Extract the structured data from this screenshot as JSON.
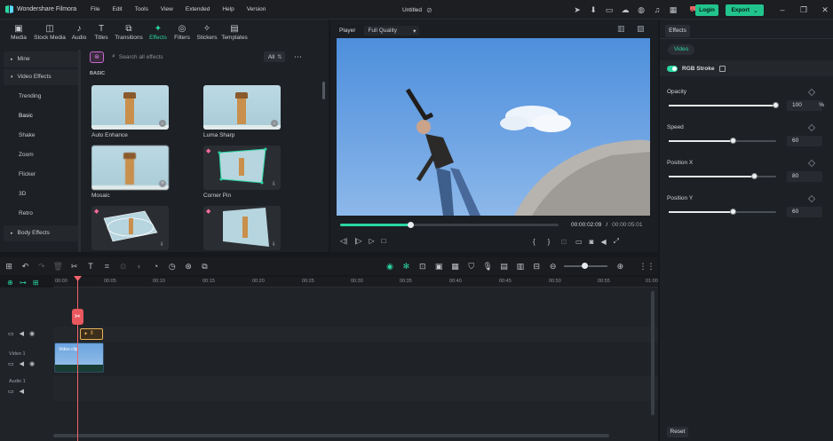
{
  "app": {
    "name": "Wondershare Filmora",
    "doc_title": "Untitled"
  },
  "menu": [
    "File",
    "Edit",
    "Tools",
    "View",
    "Extended",
    "Help",
    "Version"
  ],
  "header_buttons": {
    "login": "Login",
    "export": "Export"
  },
  "library_tabs": [
    {
      "label": "Media",
      "icon": "media-icon"
    },
    {
      "label": "Stock Media",
      "icon": "stock-icon"
    },
    {
      "label": "Audio",
      "icon": "audio-icon"
    },
    {
      "label": "Titles",
      "icon": "titles-icon"
    },
    {
      "label": "Transitions",
      "icon": "transitions-icon"
    },
    {
      "label": "Effects",
      "icon": "effects-icon",
      "active": true
    },
    {
      "label": "Filters",
      "icon": "filters-icon"
    },
    {
      "label": "Stickers",
      "icon": "stickers-icon"
    },
    {
      "label": "Templates",
      "icon": "templates-icon"
    }
  ],
  "search": {
    "placeholder": "Search all effects",
    "filter": "All"
  },
  "categories": {
    "mine": "Mine",
    "video_effects": "Video Effects",
    "items": [
      "Trending",
      "Basic",
      "Shake",
      "Zoom",
      "Flicker",
      "3D",
      "Retro"
    ],
    "body_effects": "Body Effects"
  },
  "section_label": "BASIC",
  "effects": [
    "Auto Enhance",
    "Luma Sharp",
    "Mosaic",
    "Corner Pin"
  ],
  "player": {
    "label": "Player",
    "quality": "Full Quality",
    "current_time": "00:00:02:09",
    "separator": "/",
    "total_time": "00:00:05:01",
    "progress": 0.32
  },
  "right_panel": {
    "tab": "Effects",
    "subtab": "Video",
    "effect_name": "RGB Stroke",
    "properties": [
      {
        "label": "Opacity",
        "value": "100",
        "unit": "%",
        "level": 1.0
      },
      {
        "label": "Speed",
        "value": "60",
        "unit": "",
        "level": 0.6
      },
      {
        "label": "Position X",
        "value": "80",
        "unit": "",
        "level": 0.8
      },
      {
        "label": "Position Y",
        "value": "60",
        "unit": "",
        "level": 0.6
      }
    ],
    "reset": "Reset"
  },
  "timeline": {
    "ruler": [
      "00:00",
      "00:05",
      "00:10",
      "00:15",
      "00:20",
      "00:25",
      "00:30",
      "00:35",
      "00:40",
      "00:45",
      "00:50",
      "00:55",
      "01:00"
    ],
    "tracks": {
      "video": "Video 1",
      "audio": "Audio 1"
    },
    "clip_label": "Video clip"
  },
  "colors": {
    "accent": "#21c48d",
    "playhead": "#f1656a",
    "effect_clip": "#e8b25a"
  }
}
